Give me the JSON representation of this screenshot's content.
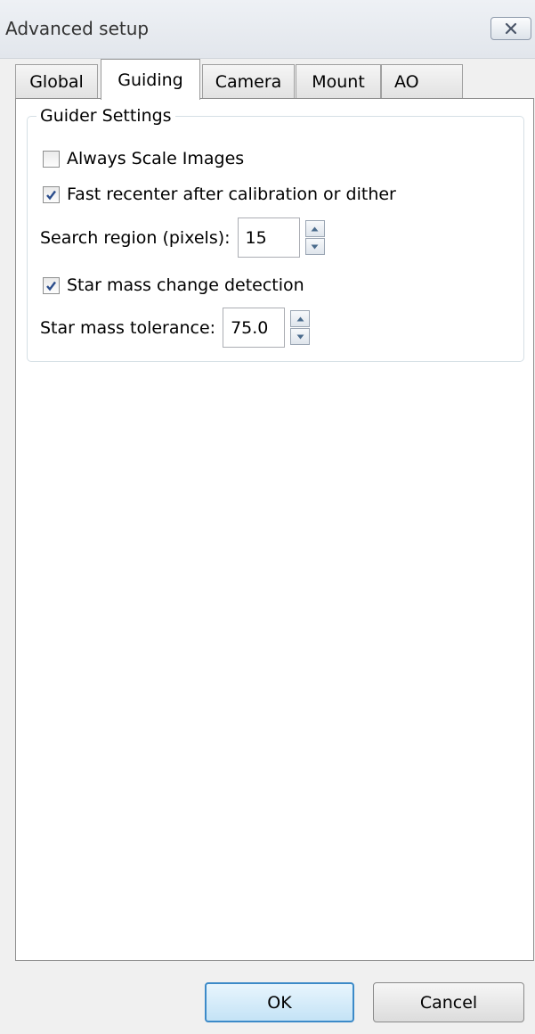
{
  "window": {
    "title": "Advanced setup",
    "close_icon": "close-icon"
  },
  "tabs": [
    {
      "label": "Global",
      "active": false
    },
    {
      "label": "Guiding",
      "active": true
    },
    {
      "label": "Camera",
      "active": false
    },
    {
      "label": "Mount",
      "active": false
    },
    {
      "label": "AO",
      "active": false
    }
  ],
  "guider_settings": {
    "title": "Guider Settings",
    "always_scale_images": {
      "label": "Always Scale Images",
      "checked": false
    },
    "fast_recenter": {
      "label": "Fast recenter after calibration or dither",
      "checked": true
    },
    "search_region": {
      "label": "Search region (pixels):",
      "value": "15"
    },
    "star_mass_detection": {
      "label": "Star mass change detection",
      "checked": true
    },
    "star_mass_tolerance": {
      "label": "Star mass tolerance:",
      "value": "75.0"
    }
  },
  "buttons": {
    "ok": "OK",
    "cancel": "Cancel"
  },
  "colors": {
    "ok_border": "#3c8ac8",
    "check_mark": "#2b4d8c"
  }
}
